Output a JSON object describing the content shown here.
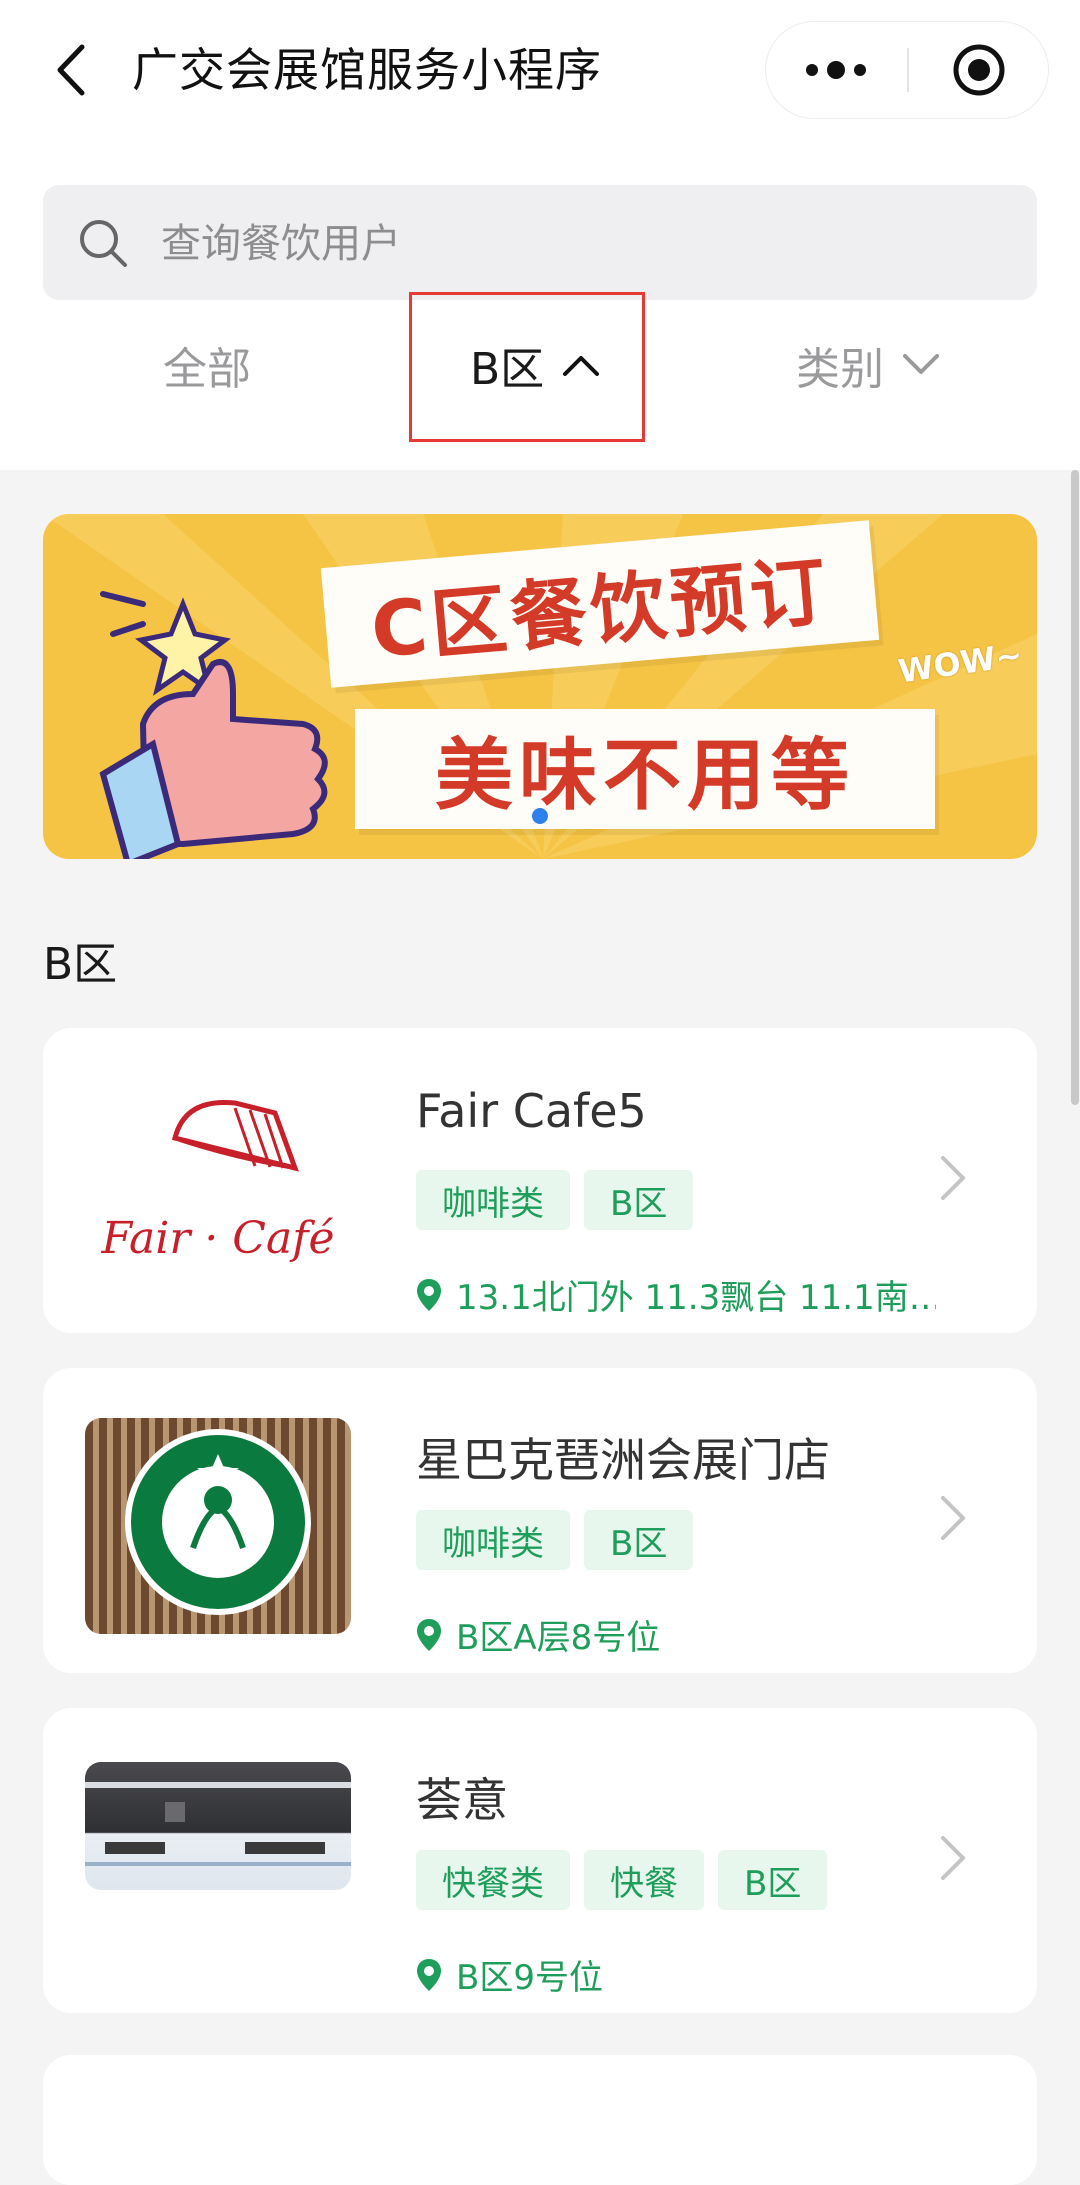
{
  "nav": {
    "title": "广交会展馆服务小程序"
  },
  "search": {
    "placeholder": "查询餐饮用户"
  },
  "filters": {
    "all_label": "全部",
    "area_label": "B区",
    "category_label": "类别"
  },
  "banner": {
    "title": "C区餐饮预订",
    "subtitle": "美味不用等",
    "wow": "WOW~"
  },
  "section": {
    "title": "B区"
  },
  "restaurants": [
    {
      "name": "Fair Cafe5",
      "tags": [
        "咖啡类",
        "B区"
      ],
      "location": "13.1北门外 11.3飘台 11.1南…",
      "logo_text": "Fair · Café"
    },
    {
      "name": "星巴克琶洲会展门店",
      "tags": [
        "咖啡类",
        "B区"
      ],
      "location": "B区A层8号位"
    },
    {
      "name": "荟意",
      "tags": [
        "快餐类",
        "快餐",
        "B区"
      ],
      "location": "B区9号位"
    }
  ],
  "colors": {
    "accent_green": "#1e9e5a",
    "tag_bg": "#e7f7ee",
    "highlight_red": "#e53935",
    "banner_yellow": "#f6c445"
  }
}
